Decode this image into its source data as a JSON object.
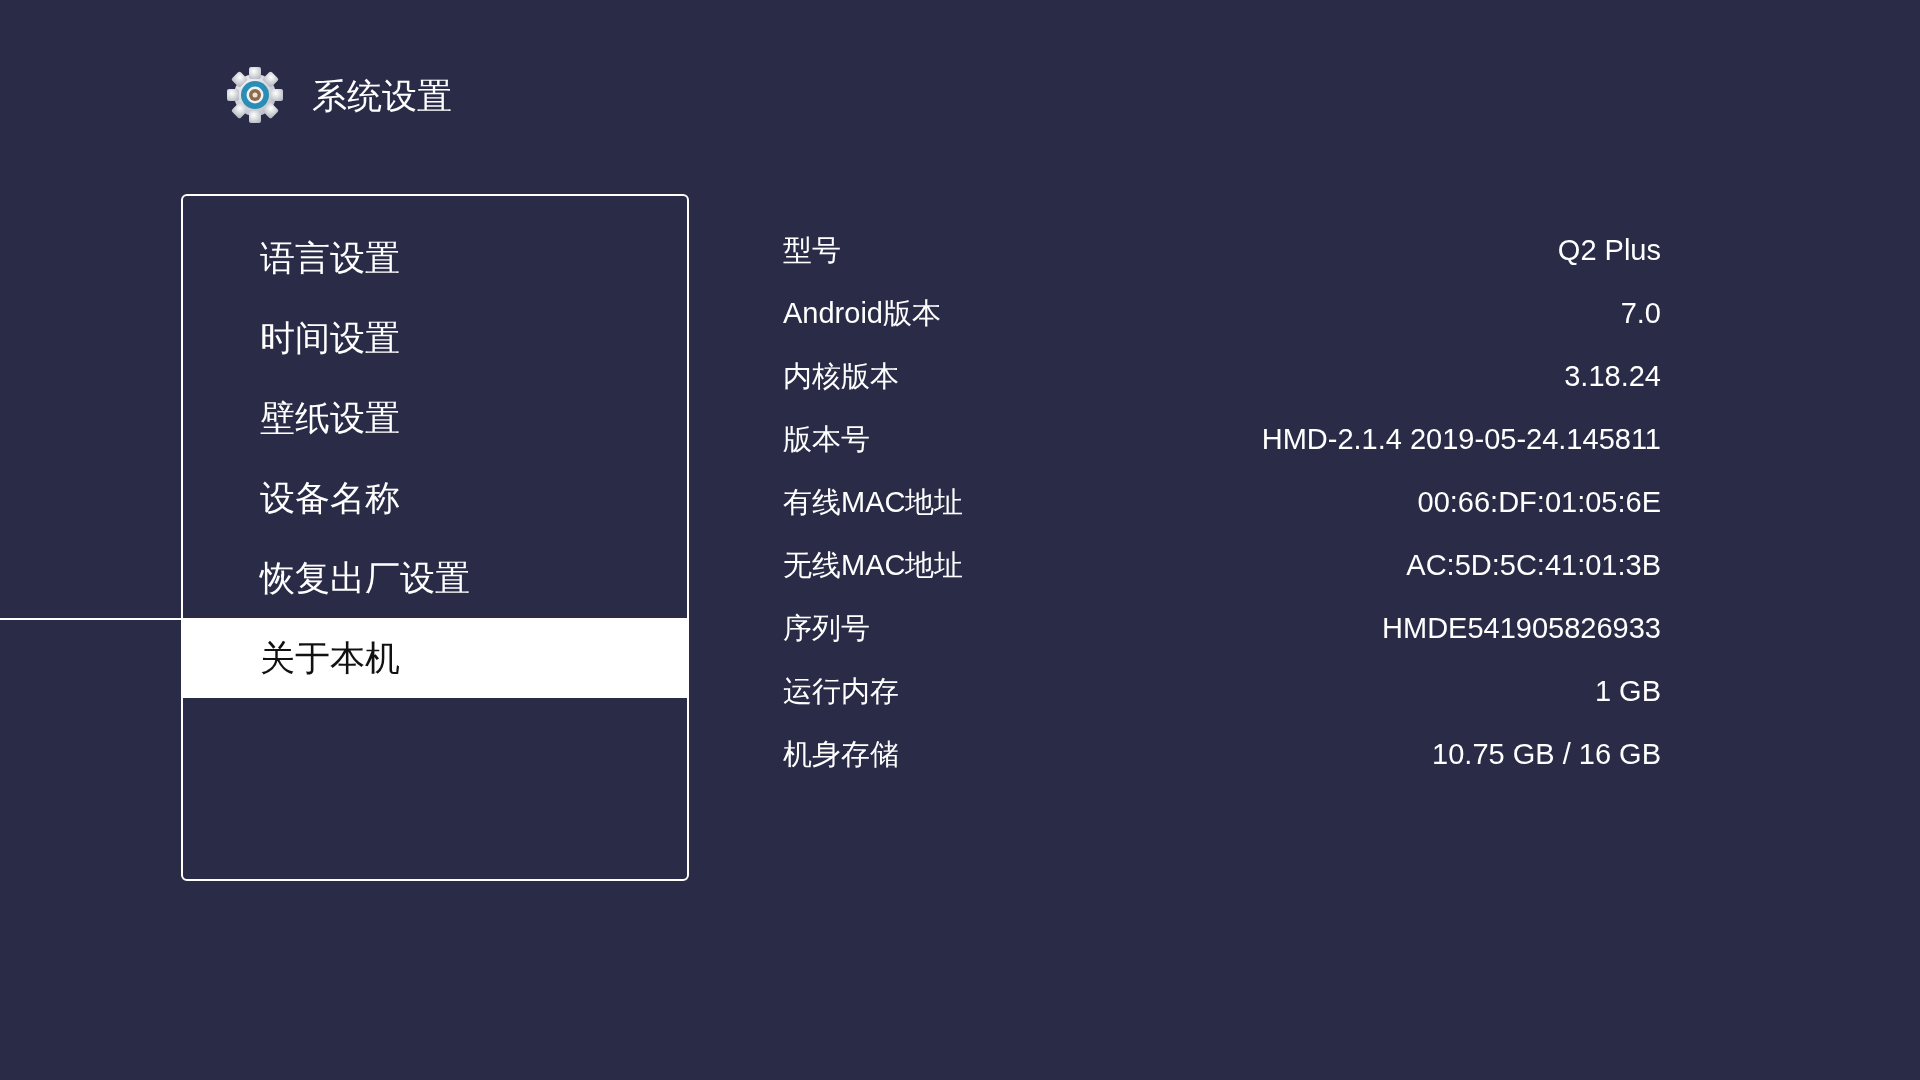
{
  "header": {
    "title": "系统设置"
  },
  "menu": {
    "items": [
      {
        "label": "语言设置",
        "selected": false
      },
      {
        "label": "时间设置",
        "selected": false
      },
      {
        "label": "壁纸设置",
        "selected": false
      },
      {
        "label": "设备名称",
        "selected": false
      },
      {
        "label": "恢复出厂设置",
        "selected": false
      },
      {
        "label": "关于本机",
        "selected": true
      }
    ]
  },
  "info": {
    "rows": [
      {
        "label": "型号",
        "value": "Q2 Plus"
      },
      {
        "label": "Android版本",
        "value": "7.0"
      },
      {
        "label": "内核版本",
        "value": "3.18.24"
      },
      {
        "label": "版本号",
        "value": "HMD-2.1.4 2019-05-24.145811"
      },
      {
        "label": "有线MAC地址",
        "value": "00:66:DF:01:05:6E"
      },
      {
        "label": "无线MAC地址",
        "value": "AC:5D:5C:41:01:3B"
      },
      {
        "label": "序列号",
        "value": "HMDE541905826933"
      },
      {
        "label": "运行内存",
        "value": "1 GB"
      },
      {
        "label": "机身存储",
        "value": "10.75 GB / 16 GB"
      }
    ]
  }
}
